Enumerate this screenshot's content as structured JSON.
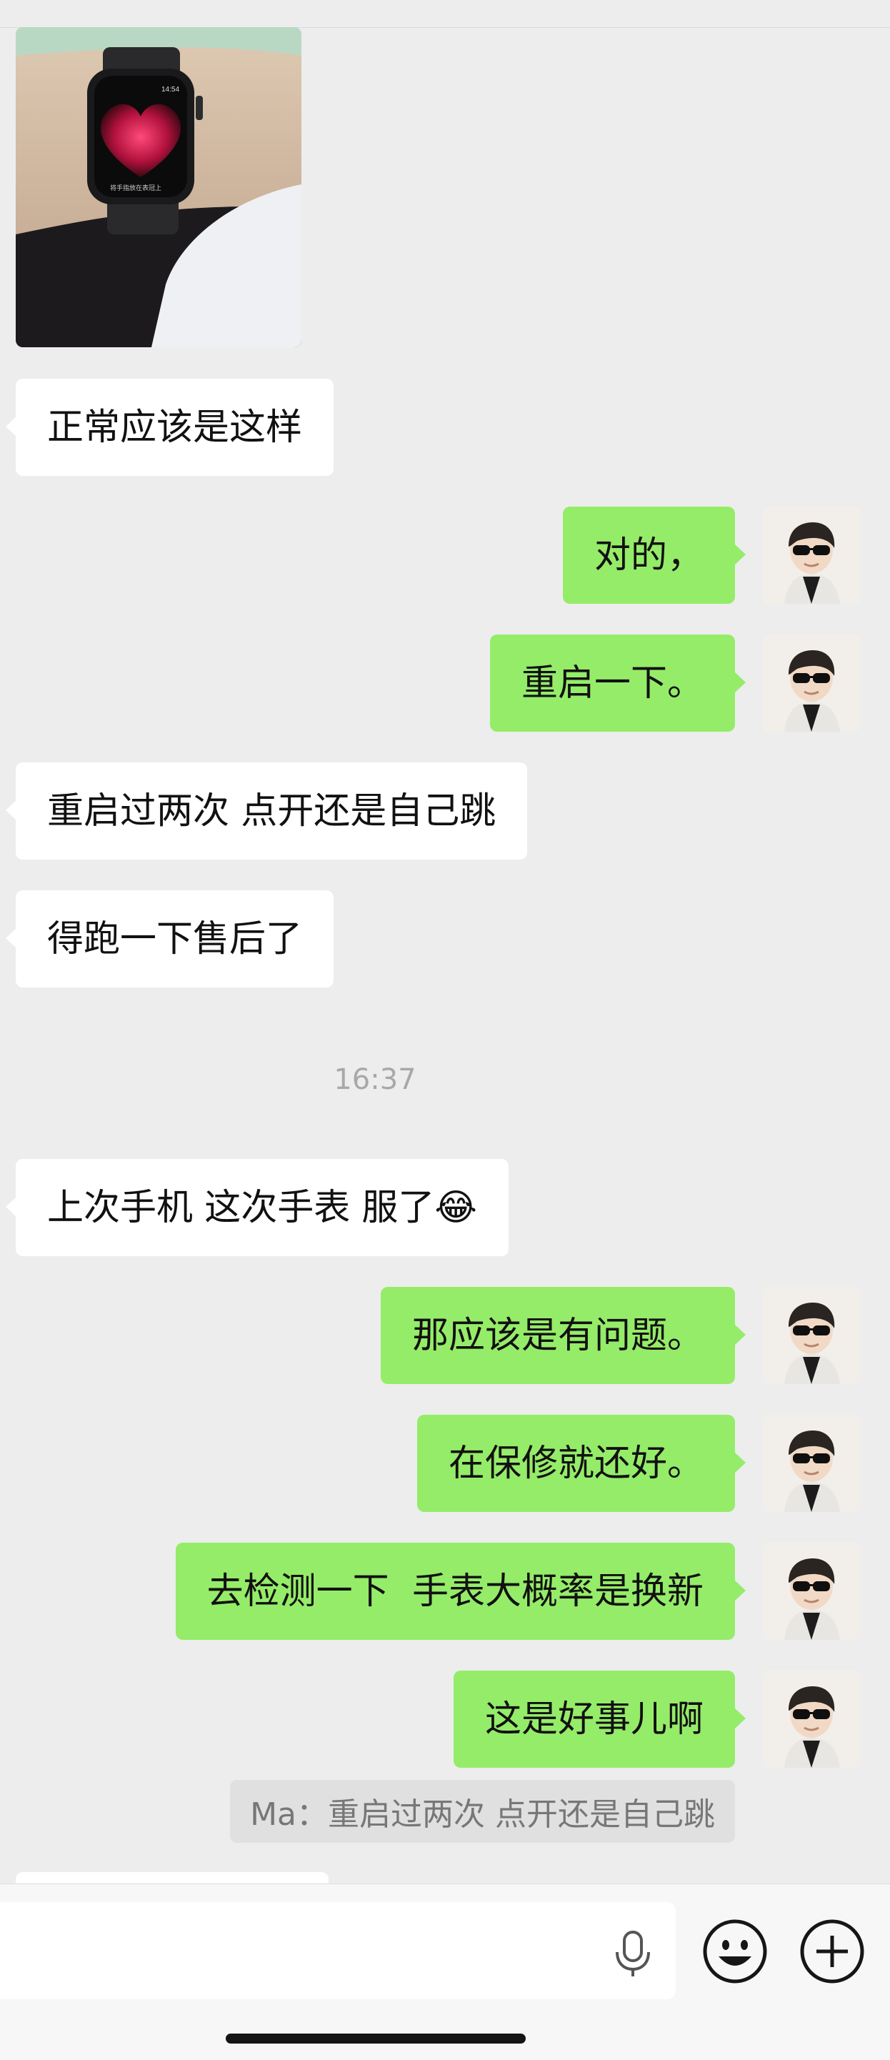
{
  "messages": [
    {
      "side": "in",
      "text": "正常应该是这样"
    },
    {
      "side": "out",
      "text": "对的，"
    },
    {
      "side": "out",
      "text": "重启一下。"
    },
    {
      "side": "in",
      "text": "重启过两次 点开还是自己跳"
    },
    {
      "side": "in",
      "text": "得跑一下售后了"
    },
    {
      "side": "in",
      "text": "上次手机 这次手表 服了😂"
    },
    {
      "side": "out",
      "text": "那应该是有问题。"
    },
    {
      "side": "out",
      "text": "在保修就还好。"
    },
    {
      "side": "out",
      "text": "去检测一下  手表大概率是换新"
    },
    {
      "side": "out",
      "text": "这是好事儿啊"
    }
  ],
  "timestamp": "16:37",
  "quote": "Ma：重启过两次 点开还是自己跳",
  "photo": {
    "watch_time": "14:54",
    "watch_caption": "将手指放在表冠上"
  },
  "input": {
    "placeholder": ""
  },
  "icons": {
    "voice": "microphone-icon",
    "emoji": "emoji-icon",
    "more": "plus-icon",
    "avatar": "user-avatar"
  },
  "colors": {
    "background": "#EDEDED",
    "incoming": "#FFFFFF",
    "outgoing": "#95EC69",
    "timestamp": "#A8A8A8"
  }
}
